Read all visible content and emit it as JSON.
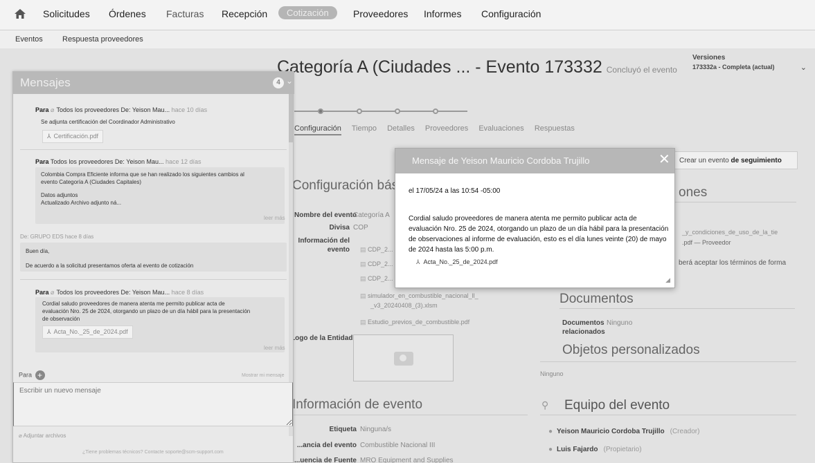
{
  "nav": {
    "items": [
      "Solicitudes",
      "Órdenes",
      "Facturas",
      "Recepción",
      "Cotización",
      "Proveedores",
      "Informes",
      "Configuración"
    ]
  },
  "subnav": [
    "Eventos",
    "Respuesta proveedores"
  ],
  "event": {
    "title": "Categoría A (Ciudades ... - Evento 173332",
    "status": "Concluyó el evento",
    "versions_label": "Versiones",
    "version_selected": "173332a - Completa (actual)",
    "tabs": [
      "Configuración",
      "Tiempo",
      "Detalles",
      "Proveedores",
      "Evaluaciones",
      "Respuestas"
    ],
    "follow_up_prefix": "Crear un evento ",
    "follow_up_bold": "de seguimiento"
  },
  "config": {
    "heading": "Configuración básica",
    "name_label": "Nombre del evento",
    "name_value": "Categoría A",
    "currency_label": "Divisa",
    "currency_value": "COP",
    "info_label_1": "Información del",
    "info_label_2": "evento",
    "files": [
      "CDP_2...",
      "CDP_2...",
      "CDP_2...",
      "simulador_en_combustible_nacional_ll_",
      "_v3_20240408_(3).xlsm",
      "Estudio_previos_de_combustible.pdf"
    ],
    "logo_label": "Logo de la Entidad"
  },
  "right_col": {
    "heading_partial": "ones",
    "terms_line": "_y_condiciones_de_uso_de_la_tie",
    "terms_sub": ".pdf — Proveedor",
    "accept_line": "berá aceptar los términos de forma",
    "documents_heading": "Documentos",
    "docs_label_1": "Documentos",
    "docs_label_2": "relacionados",
    "docs_value": "Ninguno",
    "custom_heading": "Objetos personalizados",
    "custom_value": "Ninguno",
    "team_heading": "Equipo del evento",
    "team": [
      {
        "name": "Yeison Mauricio Cordoba Trujillo",
        "role": "(Creador)"
      },
      {
        "name": "Luis Fajardo",
        "role": "(Propietario)"
      }
    ]
  },
  "event_info": {
    "heading": "Información de evento",
    "tag_label": "Etiqueta",
    "tag_value": "Ninguna/s",
    "reference_label": "...ancia del evento",
    "reference_value": "Combustible Nacional III",
    "source_label": "...uencia de Fuente",
    "source_value": "MRO Equipment and Supplies"
  },
  "messages": {
    "title": "Mensajes",
    "count": "4",
    "m1_to": "Para",
    "m1_recipients": "Todos los proveedores De: Yeison Mau...",
    "m1_time": "hace 10 días",
    "m1_text": "Se adjunta certificación del Coordinador Administrativo",
    "m1_file": "Certificación.pdf",
    "m2_to": "Para",
    "m2_recipients": "Todos los proveedores De: Yeison Mau...",
    "m2_time": "hace 12 días",
    "m2_text_1": "Colombia Compra Eficiente informa que se han realizado los siguientes cambios al",
    "m2_text_2": "evento Categoría A (Ciudades Capitales)",
    "m2_text_3": "Datos adjuntos",
    "m2_text_4": "Actualizado Archivo adjunto ná...",
    "m2_more": "leer más",
    "m3_from": "De: GRUPO EDS",
    "m3_time": "hace 8 días",
    "m3_text_1": "Buen día,",
    "m3_text_2": "De acuerdo a la solicitud presentamos oferta al evento de cotización",
    "m4_to": "Para",
    "m4_recipients": "Todos los proveedores De: Yeison Mau...",
    "m4_time": "hace 8 días",
    "m4_text_1": "Cordial saludo proveedores de manera atenta me permito publicar acta de",
    "m4_text_2": "evaluación Nro. 25 de 2024, otorgando un plazo de un día hábil para la presentación",
    "m4_text_3": "de observación",
    "m4_file": "Acta_No._25_de_2024.pdf",
    "m4_more": "leer más",
    "compose_to": "Para",
    "compose_link": "Mostrar mi mensaje",
    "compose_placeholder": "Escribir un nuevo mensaje",
    "attach": "Adjuntar archivos",
    "help": "¿Tiene problemas técnicos? Contacte soporte@scm-support.com"
  },
  "modal": {
    "title": "Mensaje de Yeison Mauricio Cordoba Trujillo",
    "date": "el 17/05/24 a las 10:54 -05:00",
    "body": "Cordial saludo proveedores  de manera atenta me permito publicar acta de evaluación Nro. 25 de 2024, otorgando un plazo de un día hábil para la presentación de observaciones al informe de evaluación, esto es el día lunes veinte (20) de mayo de 2024 hasta las 5:00 p.m.",
    "attachment": "Acta_No._25_de_2024.pdf"
  }
}
